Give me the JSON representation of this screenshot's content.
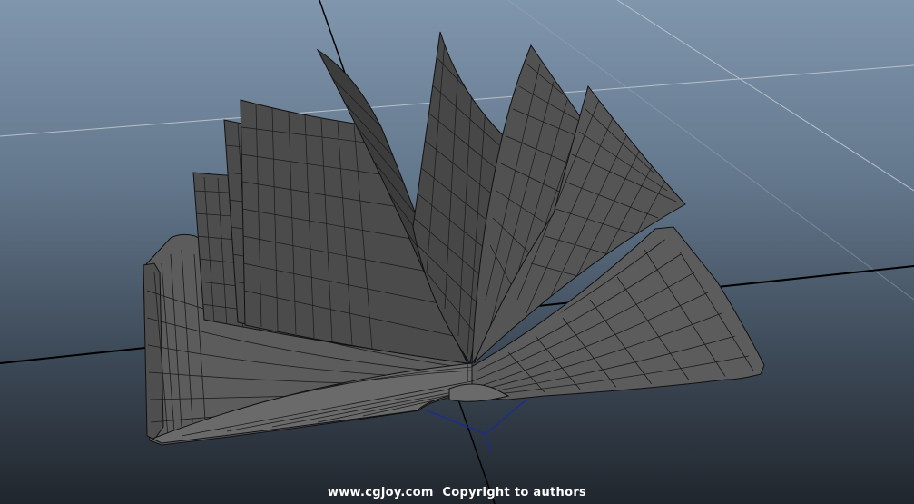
{
  "app": {
    "view": "perspective-viewport",
    "subject": "open book wireframe model"
  },
  "colors": {
    "background_top": "#8096ad",
    "background_bottom": "#20262d",
    "mesh_fill": "#4a4a4a",
    "mesh_wire": "#111111",
    "grid_light": "#b8c2cc",
    "grid_axis": "#000000",
    "rig_line": "#1a2a9a"
  },
  "watermark": {
    "text": "www.cgjoy.com  Copyright to authors"
  }
}
